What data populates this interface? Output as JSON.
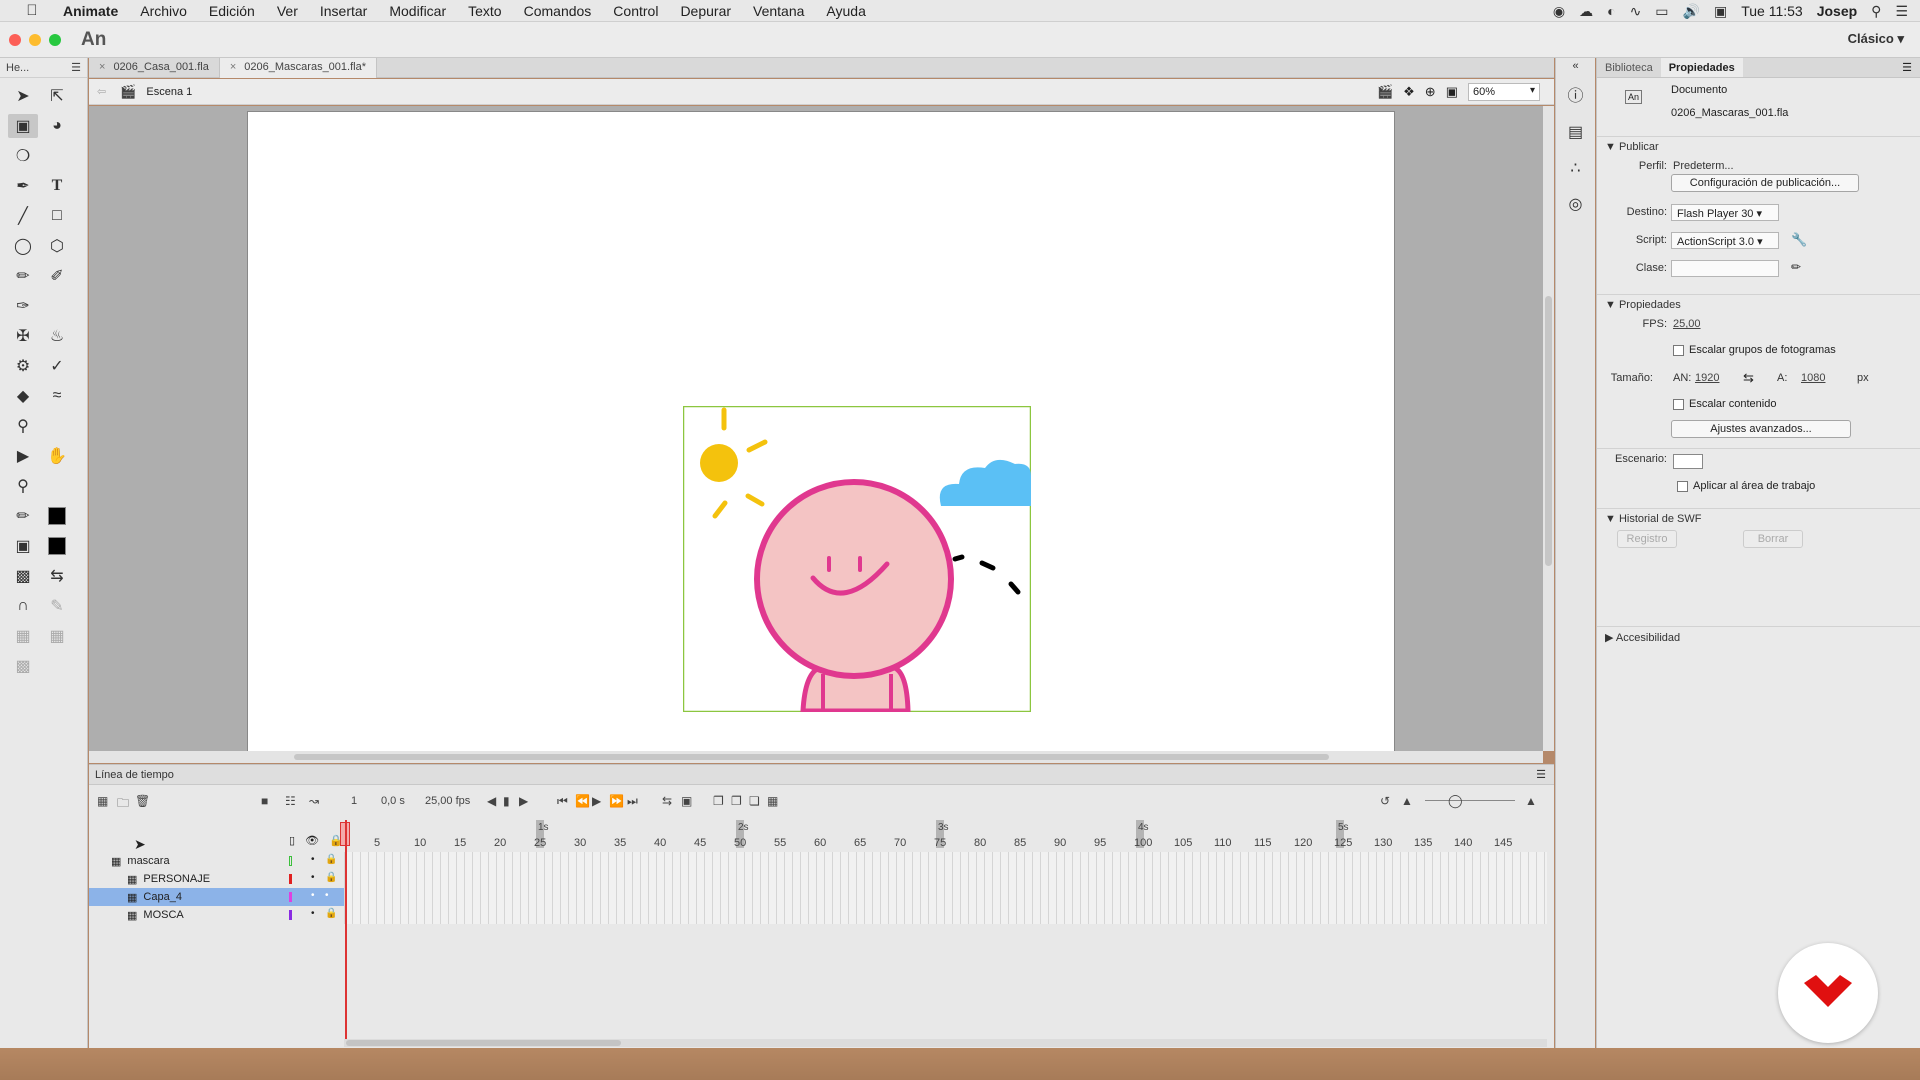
{
  "menubar": {
    "app": "Animate",
    "items": [
      "Archivo",
      "Edición",
      "Ver",
      "Insertar",
      "Modificar",
      "Texto",
      "Comandos",
      "Control",
      "Depurar",
      "Ventana",
      "Ayuda"
    ],
    "clock": "Tue 11:53",
    "user": "Josep"
  },
  "titlebar": {
    "logo": "An",
    "workspace": "Clásico"
  },
  "toolbar": {
    "header": "He..."
  },
  "tabs": [
    {
      "label": "0206_Casa_001.fla"
    },
    {
      "label": "0206_Mascaras_001.fla*"
    }
  ],
  "scene": {
    "label": "Escena 1",
    "zoom": "60%"
  },
  "timeline": {
    "title": "Línea de tiempo",
    "current_frame": "1",
    "time": "0,0 s",
    "fps": "25,00 fps",
    "ruler_seconds": [
      "1s",
      "2s",
      "3s",
      "4s",
      "5s"
    ],
    "ruler_frames": [
      "5",
      "10",
      "15",
      "20",
      "25",
      "30",
      "35",
      "40",
      "45",
      "50",
      "55",
      "60",
      "65",
      "70",
      "75",
      "80",
      "85",
      "90",
      "95",
      "100",
      "105",
      "110",
      "115",
      "120",
      "125",
      "130",
      "135",
      "140",
      "145"
    ],
    "layers": [
      {
        "name": "mascara",
        "color": "#3cbf3c",
        "indent": 0,
        "selected": false
      },
      {
        "name": "PERSONAJE",
        "color": "#e02020",
        "indent": 1,
        "selected": false
      },
      {
        "name": "Capa_4",
        "color": "#e040e0",
        "indent": 1,
        "selected": true
      },
      {
        "name": "MOSCA",
        "color": "#8a2be2",
        "indent": 1,
        "selected": false
      }
    ]
  },
  "properties": {
    "tabs": [
      "Biblioteca",
      "Propiedades"
    ],
    "doc_type": "Documento",
    "doc_name": "0206_Mascaras_001.fla",
    "publish": {
      "title": "Publicar",
      "profile_label": "Perfil:",
      "profile_value": "Predeterm...",
      "publish_settings_button": "Configuración de publicación...",
      "target_label": "Destino:",
      "target_value": "Flash Player 30",
      "script_label": "Script:",
      "script_value": "ActionScript 3.0",
      "class_label": "Clase:"
    },
    "props": {
      "title": "Propiedades",
      "fps_label": "FPS:",
      "fps_value": "25,00",
      "scale_frame_groups": "Escalar grupos de fotogramas",
      "size_label": "Tamaño:",
      "width_label": "AN:",
      "width_value": "1920",
      "height_label": "A:",
      "height_value": "1080",
      "unit": "px",
      "scale_content": "Escalar contenido",
      "advanced_button": "Ajustes avanzados...",
      "stage_label": "Escenario:",
      "apply_workspace": "Aplicar al área de trabajo"
    },
    "swf_history": {
      "title": "Historial de SWF",
      "log_button": "Registro",
      "clear_button": "Borrar"
    },
    "accessibility": {
      "title": "Accesibilidad"
    }
  },
  "colors": {
    "sun": "#f4c20d",
    "cloud": "#5bc0f5",
    "face_fill": "#f4c4c4",
    "face_stroke": "#e0388f",
    "mask_border": "#8cc63f"
  }
}
